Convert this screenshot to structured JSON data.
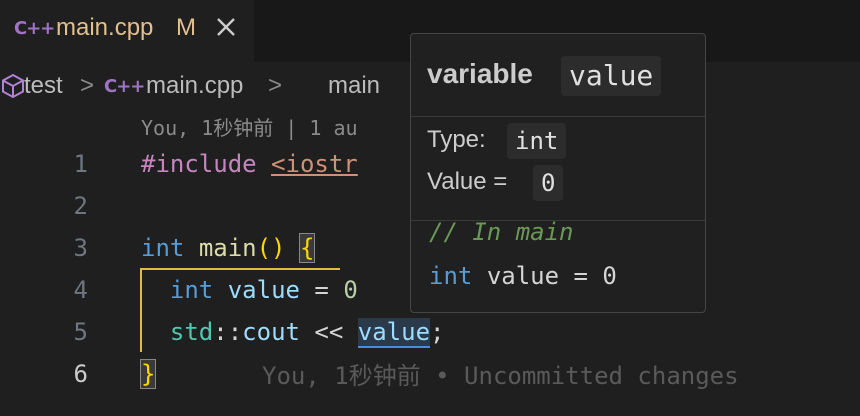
{
  "tab": {
    "icon": "cpp-file-icon",
    "icon_glyph": "C++",
    "filename": "main.cpp",
    "status": "M",
    "close": "close-icon"
  },
  "breadcrumb": {
    "folder": "test",
    "sep": ">",
    "file": "main.cpp",
    "symbol_icon": "cube-icon",
    "symbol": "main"
  },
  "codelens": "You, 1秒钟前 | 1 au",
  "lines": [
    {
      "num": "1"
    },
    {
      "num": "2"
    },
    {
      "num": "3"
    },
    {
      "num": "4"
    },
    {
      "num": "5"
    },
    {
      "num": "6"
    }
  ],
  "code": {
    "l1_directive": "#include",
    "l1_header": "<iostr",
    "l3_type": "int",
    "l3_fn": "main",
    "l3_parens": "()",
    "l3_brace": "{",
    "l4_type": "int",
    "l4_var": "value",
    "l4_eq": "=",
    "l4_num": "0",
    "l5_ns": "std",
    "l5_sep": "::",
    "l5_var": "cout",
    "l5_op": "<<",
    "l5_ref": "value",
    "l5_semi": ";",
    "l6_brace": "}"
  },
  "inline_blame": "You, 1秒钟前 • Uncommitted changes",
  "hover": {
    "title_kind": "variable",
    "title_name": "value",
    "type_label": "Type:",
    "type_value": "int",
    "value_label": "Value =",
    "value_value": "0",
    "comment": "// In main",
    "decl_type": "int",
    "decl_rest": "value = 0"
  }
}
